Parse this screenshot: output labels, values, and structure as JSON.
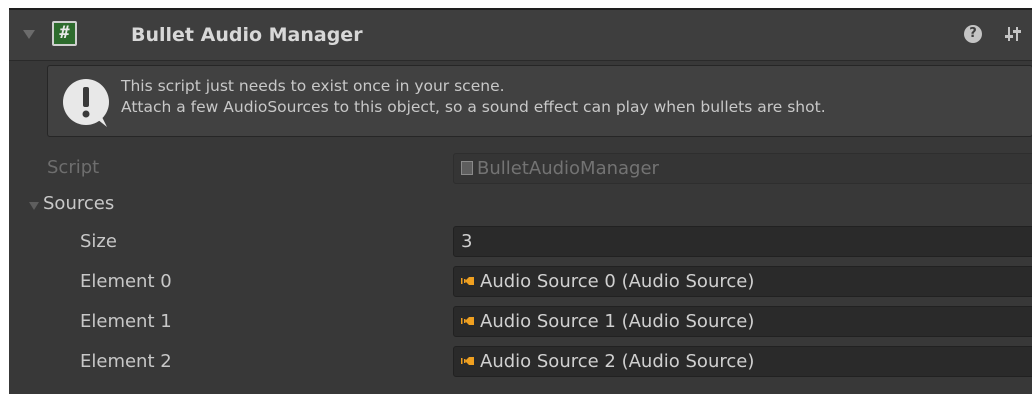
{
  "component": {
    "title": "Bullet Audio Manager",
    "script_glyph": "#",
    "help_glyph": "?"
  },
  "helpbox": {
    "icon_glyph": "!",
    "line1": "This script just needs to exist once in your scene.",
    "line2": "Attach a few AudioSources to this object, so a sound effect can play when bullets are shot."
  },
  "script_field": {
    "label": "Script",
    "value": "BulletAudioManager"
  },
  "sources": {
    "label": "Sources",
    "size_label": "Size",
    "size_value": "3",
    "elements": [
      {
        "label": "Element 0",
        "value": "Audio Source 0 (Audio Source)"
      },
      {
        "label": "Element 1",
        "value": "Audio Source 1 (Audio Source)"
      },
      {
        "label": "Element 2",
        "value": "Audio Source 2 (Audio Source)"
      }
    ]
  },
  "colors": {
    "panel_bg": "#383838",
    "header_bg": "#3e3e3e",
    "field_bg": "#2a2a2a",
    "speaker_icon": "#f0a020"
  }
}
